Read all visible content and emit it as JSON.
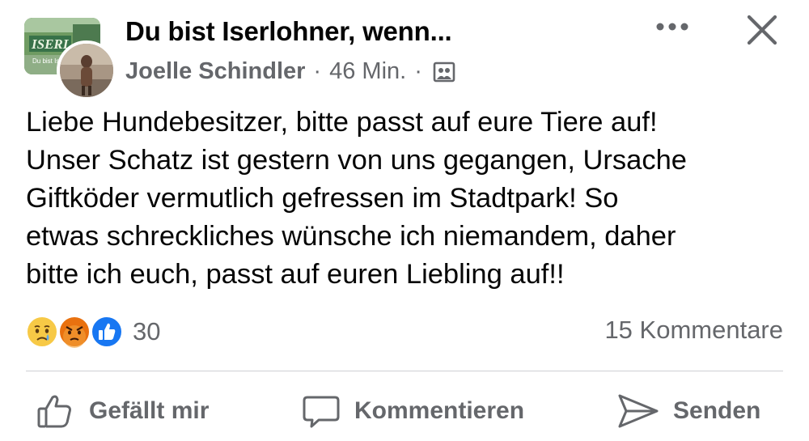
{
  "header": {
    "group_name": "Du bist Iserlohner, wenn...",
    "author": "Joelle Schindler",
    "separator": "·",
    "time": "46 Min.",
    "group_avatar_text": "ISERL",
    "group_avatar_subtext": "Du bist Iser"
  },
  "post": {
    "lines": [
      "Liebe Hundebesitzer, bitte passt auf eure Tiere auf!",
      "Unser Schatz ist gestern von uns gegangen, Ursache",
      "Giftköder vermutlich gefressen im Stadtpark! So",
      "etwas schreckliches wünsche ich niemandem, daher",
      "bitte ich euch, passt auf euren Liebling auf!!"
    ]
  },
  "stats": {
    "reaction_count": "30",
    "comments": "15 Kommentare",
    "reactions": [
      "sad",
      "angry",
      "like"
    ]
  },
  "actions": {
    "like": "Gefällt mir",
    "comment": "Kommentieren",
    "share": "Senden"
  },
  "icons": {
    "more": "more-horizontal-icon",
    "close": "close-icon",
    "audience": "group-audience-icon",
    "like": "thumbs-up-icon",
    "comment": "comment-bubble-icon",
    "share": "send-arrow-icon"
  },
  "colors": {
    "text": "#050505",
    "secondary": "#65676b",
    "divider": "#ced0d4",
    "like_blue": "#1877f2",
    "angry_red": "#e9710f"
  }
}
